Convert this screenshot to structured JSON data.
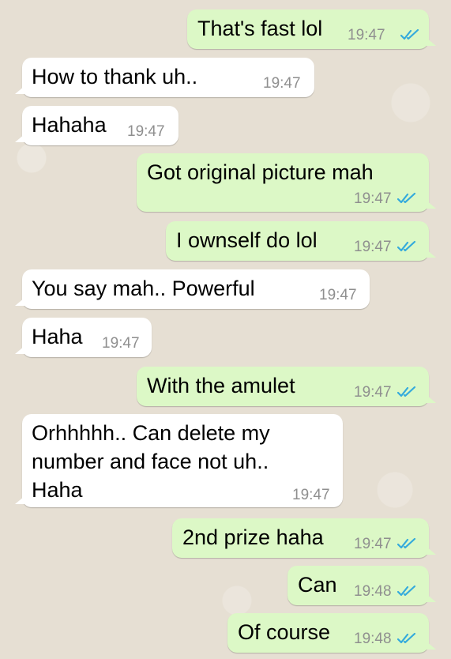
{
  "colors": {
    "incoming_bubble": "#ffffff",
    "outgoing_bubble": "#dcf8c6",
    "read_ticks": "#34aadc",
    "timestamp": "#8f8f8f"
  },
  "messages": [
    {
      "direction": "outgoing",
      "text": "That's fast lol",
      "time": "19:47",
      "status": "read"
    },
    {
      "direction": "incoming",
      "text": "How to thank uh..",
      "time": "19:47"
    },
    {
      "direction": "incoming",
      "text": "Hahaha",
      "time": "19:47"
    },
    {
      "direction": "outgoing",
      "text": "Got original picture mah",
      "time": "19:47",
      "status": "read"
    },
    {
      "direction": "outgoing",
      "text": "I ownself do lol",
      "time": "19:47",
      "status": "read"
    },
    {
      "direction": "incoming",
      "text": "You say mah.. Powerful",
      "time": "19:47"
    },
    {
      "direction": "incoming",
      "text": "Haha",
      "time": "19:47"
    },
    {
      "direction": "outgoing",
      "text": "With the amulet",
      "time": "19:47",
      "status": "read"
    },
    {
      "direction": "incoming",
      "text_lines": [
        "Orhhhhh.. Can delete my",
        "number and face not uh..",
        "Haha"
      ],
      "time": "19:47"
    },
    {
      "direction": "outgoing",
      "text": "2nd prize haha",
      "time": "19:47",
      "status": "read"
    },
    {
      "direction": "outgoing",
      "text": "Can",
      "time": "19:48",
      "status": "read"
    },
    {
      "direction": "outgoing",
      "text": "Of course",
      "time": "19:48",
      "status": "read"
    }
  ]
}
